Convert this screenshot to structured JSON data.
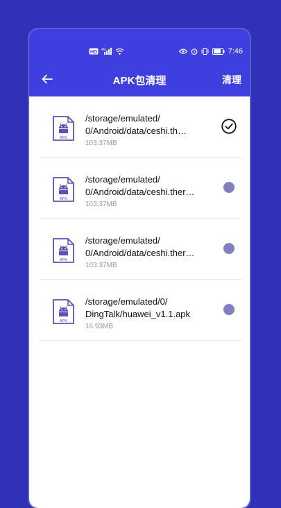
{
  "status_bar": {
    "time": "7:46",
    "left_icons": [
      "hd-icon",
      "4g-signal-icon",
      "wifi-icon"
    ],
    "right_icons": [
      "eye-icon",
      "alarm-icon",
      "vibrate-icon",
      "battery-icon"
    ]
  },
  "header": {
    "title": "APK包清理",
    "action_label": "清理"
  },
  "files": [
    {
      "path_line1": "/storage/emulated/",
      "path_line2": "0/Android/data/ceshi.th…",
      "size": "103.37MB",
      "selected": true
    },
    {
      "path_line1": "/storage/emulated/",
      "path_line2": "0/Android/data/ceshi.ther…",
      "size": "103.37MB",
      "selected": false
    },
    {
      "path_line1": "/storage/emulated/",
      "path_line2": "0/Android/data/ceshi.ther…",
      "size": "103.37MB",
      "selected": false
    },
    {
      "path_line1": "/storage/emulated/0/",
      "path_line2": "DingTalk/huawei_v1.1.apk",
      "size": "16.93MB",
      "selected": false
    }
  ],
  "icon_label": "APK",
  "colors": {
    "header_bg": "#3f3fe0",
    "page_bg": "#3131b7",
    "icon_accent": "#5b4fb8",
    "dot_unselected": "#8080c0"
  }
}
